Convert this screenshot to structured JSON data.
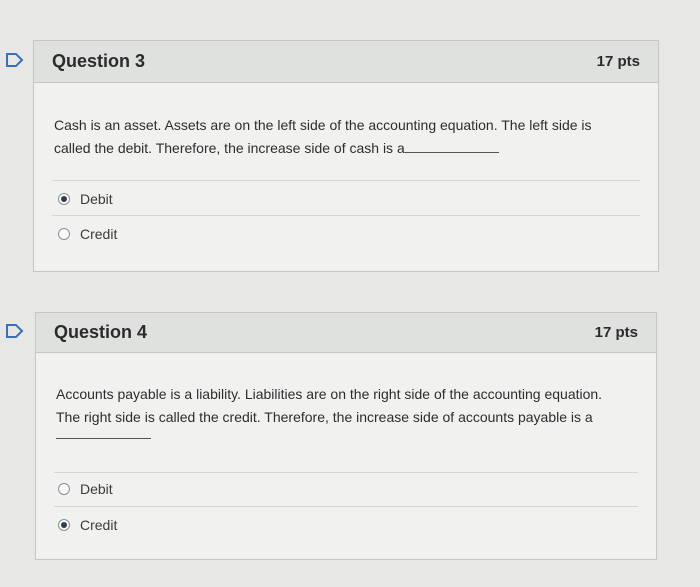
{
  "questions": [
    {
      "title": "Question 3",
      "points": "17 pts",
      "text_line1": "Cash is an asset. Assets are on the left side of the accounting equation. The left side is",
      "text_line2": "called the debit. Therefore, the increase side of cash is a",
      "answers": [
        {
          "label": "Debit",
          "selected": true
        },
        {
          "label": "Credit",
          "selected": false
        }
      ]
    },
    {
      "title": "Question 4",
      "points": "17 pts",
      "text_line1": "Accounts payable is a liability. Liabilities are on the right side of the accounting equation.",
      "text_line2": "The right side is called the credit. Therefore, the increase side of accounts payable is a",
      "answers": [
        {
          "label": "Debit",
          "selected": false
        },
        {
          "label": "Credit",
          "selected": true
        }
      ]
    }
  ],
  "icons": {
    "flag": "flag-question-icon"
  },
  "colors": {
    "background": "#e7e8e6",
    "header": "#dfe1df",
    "flag": "#3b6fb8"
  }
}
